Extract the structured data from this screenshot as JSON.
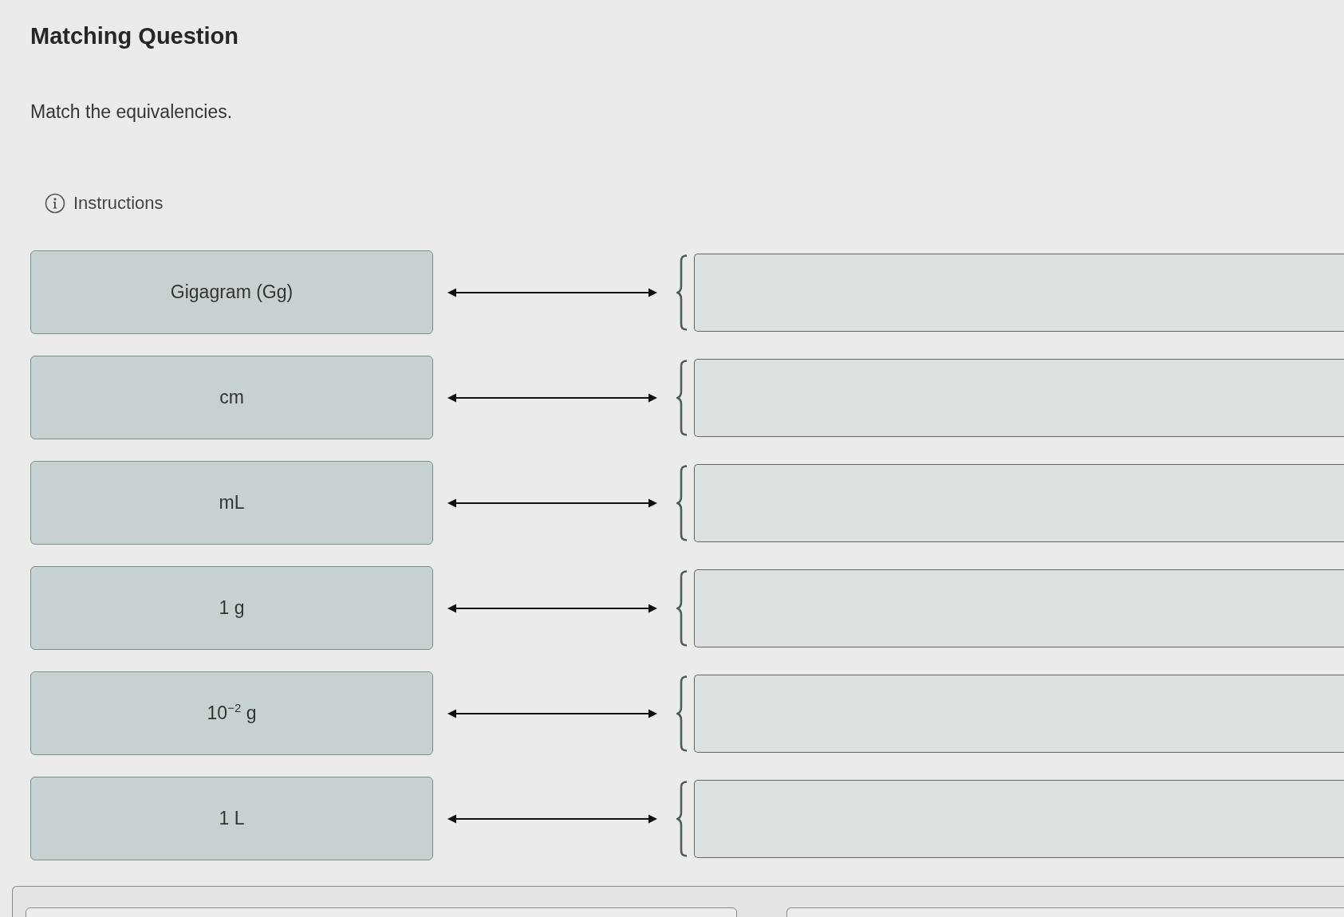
{
  "title": "Matching Question",
  "prompt": "Match the equivalencies.",
  "instructions": {
    "label": "Instructions"
  },
  "pairs": [
    {
      "term": "Gigagram (Gg)"
    },
    {
      "term": "cm"
    },
    {
      "term": "mL"
    },
    {
      "term": "1 g"
    },
    {
      "term": "10$^{−2}$ g"
    },
    {
      "term": "1 L"
    }
  ]
}
